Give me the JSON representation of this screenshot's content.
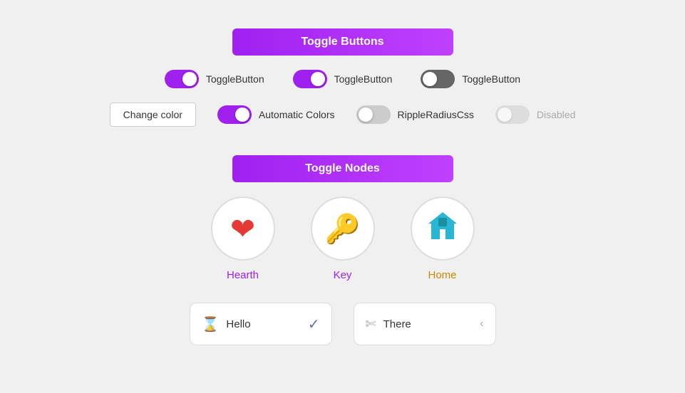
{
  "sections": {
    "toggle_buttons": {
      "label": "Toggle Buttons",
      "toggles": [
        {
          "id": "toggle1",
          "label": "ToggleButton",
          "state": "on"
        },
        {
          "id": "toggle2",
          "label": "ToggleButton",
          "state": "on"
        },
        {
          "id": "toggle3",
          "label": "ToggleButton",
          "state": "dark-off"
        }
      ]
    },
    "controls": {
      "change_color_label": "Change color",
      "items": [
        {
          "id": "auto-colors",
          "label": "Automatic Colors",
          "state": "on"
        },
        {
          "id": "ripple",
          "label": "RippleRadiusCss",
          "state": "off"
        },
        {
          "id": "disabled",
          "label": "Disabled",
          "state": "disabled"
        }
      ]
    },
    "toggle_nodes": {
      "label": "Toggle Nodes",
      "nodes": [
        {
          "id": "hearth",
          "label": "Hearth",
          "icon": "heart",
          "color_class": "hearth"
        },
        {
          "id": "key",
          "label": "Key",
          "icon": "key",
          "color_class": "key"
        },
        {
          "id": "home",
          "label": "Home",
          "icon": "home",
          "color_class": "home"
        }
      ]
    },
    "cards": [
      {
        "id": "hello-card",
        "icon": "history",
        "text": "Hello",
        "suffix_icon": "check",
        "suffix_type": "check"
      },
      {
        "id": "there-card",
        "icon": "scissors",
        "text": "There",
        "suffix_icon": "chevron-left",
        "suffix_type": "arrow"
      }
    ]
  },
  "colors": {
    "accent": "#a020f0",
    "accent_gradient_start": "#a020f0",
    "accent_gradient_end": "#c040ff"
  }
}
